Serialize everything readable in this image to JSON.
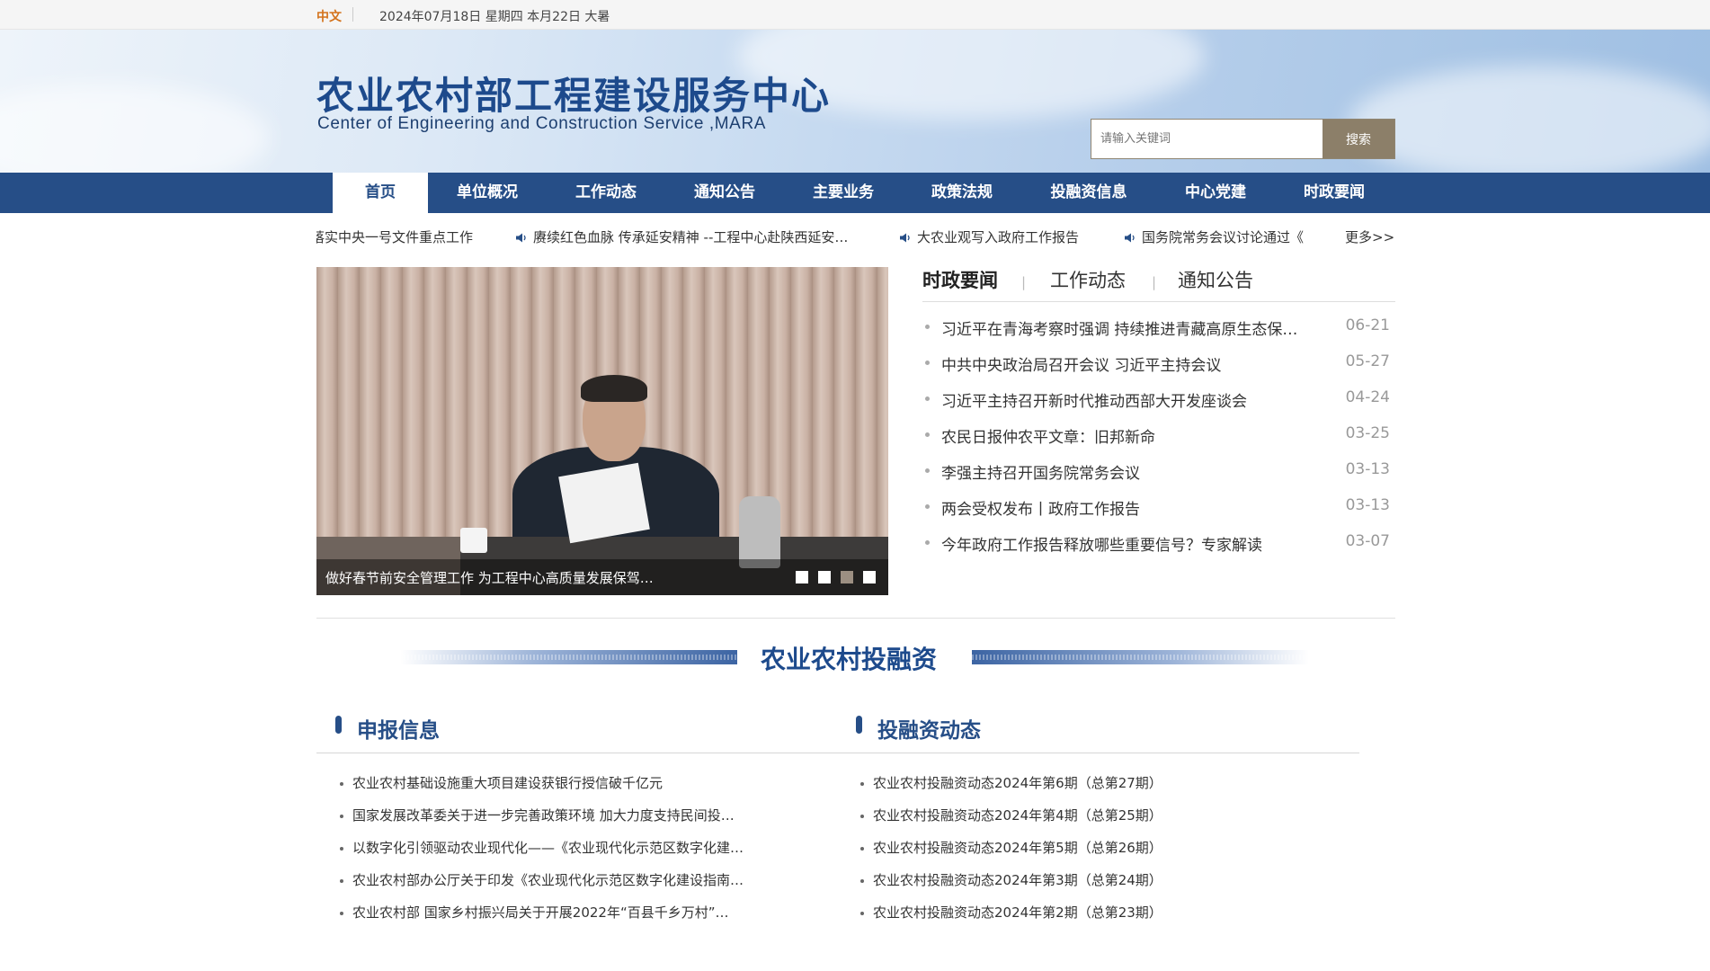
{
  "topbar": {
    "lang": "中文",
    "date": "2024年07月18日 星期四 本月22日 大暑"
  },
  "header": {
    "title_cn": "农业农村部工程建设服务中心",
    "title_en": "Center of Engineering and Construction Service ,MARA",
    "search_placeholder": "请输入关键词",
    "search_button": "搜索"
  },
  "nav": {
    "items": [
      {
        "label": "首页"
      },
      {
        "label": "单位概况"
      },
      {
        "label": "工作动态"
      },
      {
        "label": "通知公告"
      },
      {
        "label": "主要业务"
      },
      {
        "label": "政策法规"
      },
      {
        "label": "投融资信息"
      },
      {
        "label": "中心党建"
      },
      {
        "label": "时政要闻"
      }
    ]
  },
  "ticker": {
    "items": [
      "落实中央一号文件重点工作",
      "赓续红色血脉 传承延安精神 --工程中心赴陕西延安…",
      "大农业观写入政府工作报告",
      "国务院常务会议讨论通过《"
    ],
    "more": "更多>>"
  },
  "slide": {
    "caption": "做好春节前安全管理工作 为工程中心高质量发展保驾…"
  },
  "news": {
    "tabs": [
      "时政要闻",
      "工作动态",
      "通知公告"
    ],
    "items": [
      {
        "title": "习近平在青海考察时强调 持续推进青藏高原生态保…",
        "date": "06-21"
      },
      {
        "title": "中共中央政治局召开会议 习近平主持会议",
        "date": "05-27"
      },
      {
        "title": "习近平主持召开新时代推动西部大开发座谈会",
        "date": "04-24"
      },
      {
        "title": "农民日报仲农平文章：旧邦新命",
        "date": "03-25"
      },
      {
        "title": "李强主持召开国务院常务会议",
        "date": "03-13"
      },
      {
        "title": "两会受权发布丨政府工作报告",
        "date": "03-13"
      },
      {
        "title": "今年政府工作报告释放哪些重要信号？专家解读",
        "date": "03-07"
      }
    ]
  },
  "section": {
    "title": "农业农村投融资"
  },
  "left_col": {
    "title": "申报信息",
    "items": [
      "农业农村基础设施重大项目建设获银行授信破千亿元",
      "国家发展改革委关于进一步完善政策环境 加大力度支持民间投…",
      "以数字化引领驱动农业现代化——《农业现代化示范区数字化建…",
      "农业农村部办公厅关于印发《农业现代化示范区数字化建设指南…",
      "农业农村部 国家乡村振兴局关于开展2022年“百县千乡万村”…"
    ]
  },
  "right_col": {
    "title": "投融资动态",
    "items": [
      "农业农村投融资动态2024年第6期（总第27期）",
      "农业农村投融资动态2024年第4期（总第25期）",
      "农业农村投融资动态2024年第5期（总第26期）",
      "农业农村投融资动态2024年第3期（总第24期）",
      "农业农村投融资动态2024年第2期（总第23期）"
    ]
  },
  "colors": {
    "nav_bg": "#264e87",
    "brand_blue": "#1d4a8c",
    "lang_orange": "#d4731c",
    "search_button": "#8c7f69"
  }
}
